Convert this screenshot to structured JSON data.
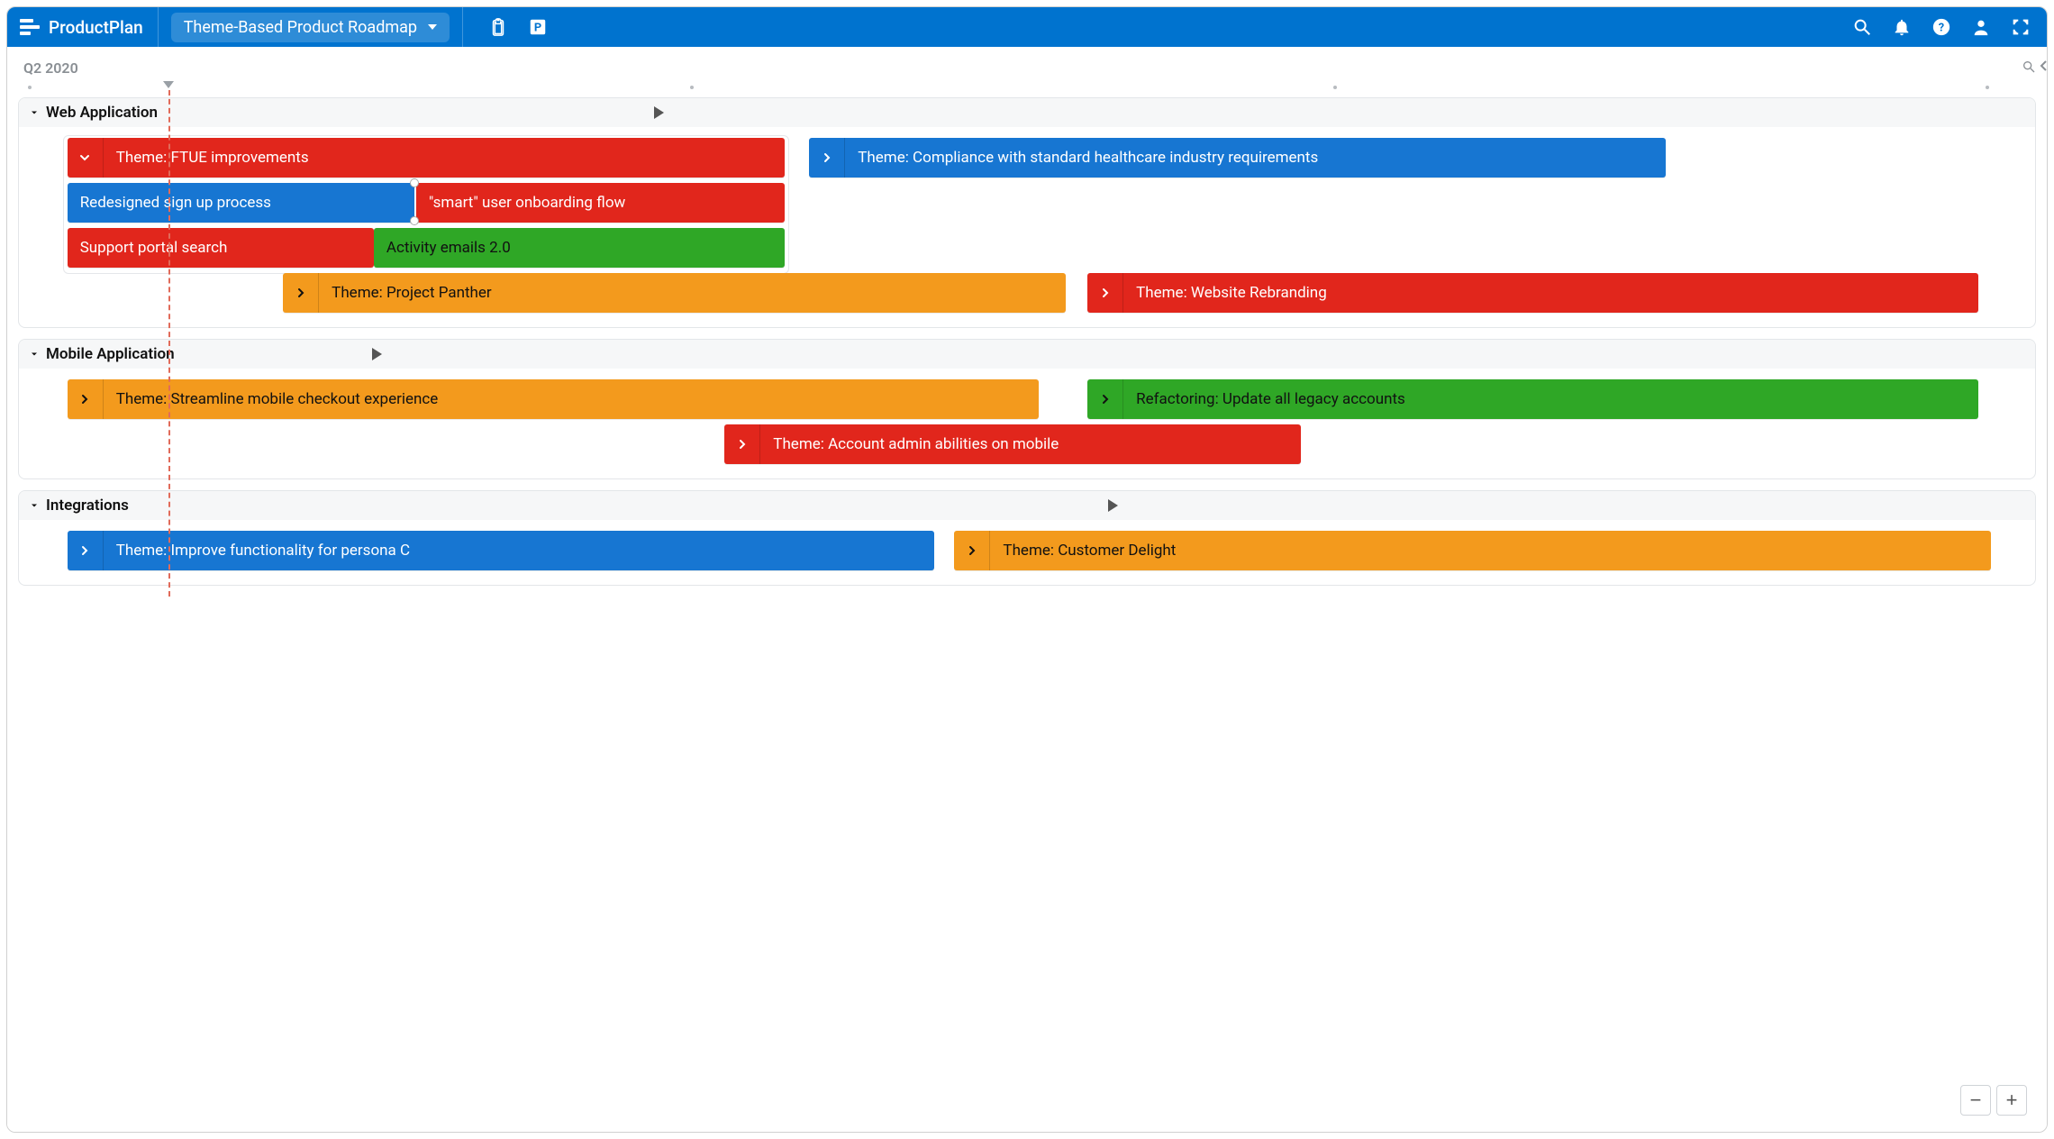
{
  "header": {
    "brand": "ProductPlan",
    "roadmap_name": "Theme-Based Product Roadmap"
  },
  "timeline": {
    "period_label": "Q2 2020",
    "today_position_pct": 7.9,
    "ticks_pct": [
      1.0,
      33.5,
      65.0,
      97.0
    ]
  },
  "lanes": [
    {
      "name": "Web Application",
      "play_marker_pct": 31.5,
      "rows": [
        {
          "group_outline": {
            "left_pct": 2.2,
            "width_pct": 36.0,
            "height_rows": 3
          },
          "bars": [
            {
              "label": "Theme: FTUE improvements",
              "color": "red",
              "chevron": "down",
              "left_pct": 2.4,
              "width_pct": 35.6
            },
            {
              "label": "Theme: Compliance with standard healthcare industry requirements",
              "color": "blue",
              "chevron": "right",
              "left_pct": 39.2,
              "width_pct": 42.5
            }
          ]
        },
        {
          "bars": [
            {
              "label": "Redesigned sign up process",
              "color": "blue",
              "chevron": "none",
              "left_pct": 2.4,
              "width_pct": 17.2,
              "connector_out": true
            },
            {
              "label": "\"smart\" user onboarding flow",
              "color": "red",
              "chevron": "none",
              "left_pct": 19.7,
              "width_pct": 18.3,
              "connector_in": true
            }
          ]
        },
        {
          "bars": [
            {
              "label": "Support portal search",
              "color": "red",
              "chevron": "none",
              "left_pct": 2.4,
              "width_pct": 15.2
            },
            {
              "label": "Activity emails 2.0",
              "color": "green",
              "chevron": "none",
              "left_pct": 17.6,
              "width_pct": 20.4,
              "text_color": "black"
            }
          ]
        },
        {
          "bars": [
            {
              "label": "Theme: Project Panther",
              "color": "orange",
              "chevron": "right",
              "left_pct": 13.1,
              "width_pct": 38.8,
              "text_color": "black"
            },
            {
              "label": "Theme: Website Rebranding",
              "color": "red",
              "chevron": "right",
              "left_pct": 53.0,
              "width_pct": 44.2
            }
          ]
        }
      ]
    },
    {
      "name": "Mobile Application",
      "play_marker_pct": 17.5,
      "rows": [
        {
          "bars": [
            {
              "label": "Theme: Streamline mobile checkout experience",
              "color": "orange",
              "chevron": "right",
              "left_pct": 2.4,
              "width_pct": 48.2,
              "text_color": "black"
            },
            {
              "label": "Refactoring: Update all legacy accounts",
              "color": "green",
              "chevron": "right",
              "left_pct": 53.0,
              "width_pct": 44.2,
              "text_color": "black"
            }
          ]
        },
        {
          "bars": [
            {
              "label": "Theme: Account admin abilities on mobile",
              "color": "red",
              "chevron": "right",
              "left_pct": 35.0,
              "width_pct": 28.6
            }
          ]
        }
      ]
    },
    {
      "name": "Integrations",
      "play_marker_pct": 54.0,
      "rows": [
        {
          "bars": [
            {
              "label": "Theme: Improve functionality for persona C",
              "color": "blue",
              "chevron": "right",
              "left_pct": 2.4,
              "width_pct": 43.0
            },
            {
              "label": "Theme: Customer Delight",
              "color": "orange",
              "chevron": "right",
              "left_pct": 46.4,
              "width_pct": 51.4,
              "text_color": "black"
            }
          ]
        }
      ]
    }
  ]
}
